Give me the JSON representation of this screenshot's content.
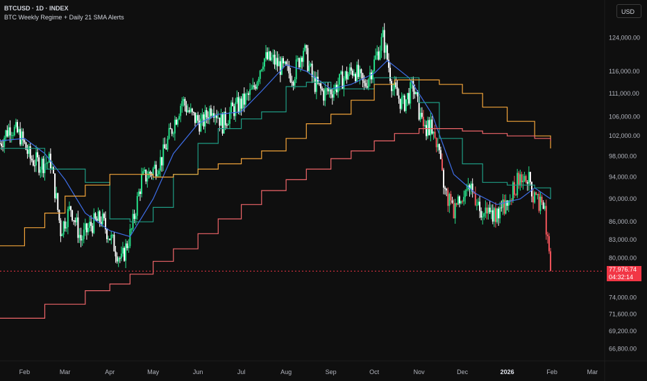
{
  "header": {
    "symbol_line": "BTCUSD · 1D · INDEX",
    "indicator_name": "BTC Weekly Regime + Daily 21 SMA Alerts",
    "currency_button": "USD"
  },
  "price_tag": {
    "price": "77,976.74",
    "countdown": "04:32:14"
  },
  "colors": {
    "background": "#0f0f0f",
    "candle_up": "#26e08a",
    "candle_down": "#ffffff",
    "candle_down_bear": "#f2545b",
    "sma21_daily": "#3e6ee8",
    "weekly_line_teal": "#1f9c84",
    "weekly_line_orange": "#f4a53a",
    "weekly_line_red": "#f0666a",
    "current_price": "#f23645"
  },
  "chart_data": {
    "type": "line",
    "title": "",
    "xlabel": "",
    "ylabel": "",
    "x_ticks": [
      {
        "label": "Feb",
        "bold": false
      },
      {
        "label": "Mar",
        "bold": false
      },
      {
        "label": "Apr",
        "bold": false
      },
      {
        "label": "May",
        "bold": false
      },
      {
        "label": "Jun",
        "bold": false
      },
      {
        "label": "Jul",
        "bold": false
      },
      {
        "label": "Aug",
        "bold": false
      },
      {
        "label": "Sep",
        "bold": false
      },
      {
        "label": "Oct",
        "bold": false
      },
      {
        "label": "Nov",
        "bold": false
      },
      {
        "label": "Dec",
        "bold": false
      },
      {
        "label": "2026",
        "bold": true
      },
      {
        "label": "Feb",
        "bold": false
      },
      {
        "label": "Mar",
        "bold": false
      }
    ],
    "y_ticks": [
      "124,000.00",
      "116,000.00",
      "111,000.00",
      "106,000.00",
      "102,000.00",
      "98,000.00",
      "94,000.00",
      "90,000.00",
      "86,000.00",
      "83,000.00",
      "80,000.00",
      "74,000.00",
      "71,600.00",
      "69,200.00",
      "66,800.00"
    ],
    "y_tick_values": [
      124000,
      116000,
      111000,
      106000,
      102000,
      98000,
      94000,
      90000,
      86000,
      83000,
      80000,
      74000,
      71600,
      69200,
      66800
    ],
    "y_scale": "log",
    "ylim": [
      65500,
      130000
    ],
    "x_range": [
      "2025-01-15",
      "2026-03-08"
    ],
    "last_price": 77976.74,
    "candles_close": [
      [
        "2025-01-15",
        100500
      ],
      [
        "2025-01-22",
        104000
      ],
      [
        "2025-01-29",
        102000
      ],
      [
        "2025-02-05",
        97500
      ],
      [
        "2025-02-12",
        96500
      ],
      [
        "2025-02-19",
        97000
      ],
      [
        "2025-02-26",
        84500
      ],
      [
        "2025-03-05",
        88500
      ],
      [
        "2025-03-12",
        83000
      ],
      [
        "2025-03-19",
        85500
      ],
      [
        "2025-03-26",
        86500
      ],
      [
        "2025-04-02",
        83000
      ],
      [
        "2025-04-09",
        79500
      ],
      [
        "2025-04-16",
        84500
      ],
      [
        "2025-04-23",
        93500
      ],
      [
        "2025-04-30",
        95000
      ],
      [
        "2025-05-07",
        97500
      ],
      [
        "2025-05-14",
        103500
      ],
      [
        "2025-05-21",
        109500
      ],
      [
        "2025-05-28",
        106000
      ],
      [
        "2025-06-04",
        104500
      ],
      [
        "2025-06-11",
        108500
      ],
      [
        "2025-06-18",
        104500
      ],
      [
        "2025-06-25",
        107500
      ],
      [
        "2025-07-02",
        109000
      ],
      [
        "2025-07-09",
        111500
      ],
      [
        "2025-07-16",
        119000
      ],
      [
        "2025-07-23",
        118500
      ],
      [
        "2025-07-30",
        116500
      ],
      [
        "2025-08-06",
        115000
      ],
      [
        "2025-08-13",
        121500
      ],
      [
        "2025-08-20",
        113500
      ],
      [
        "2025-08-27",
        111000
      ],
      [
        "2025-09-03",
        112000
      ],
      [
        "2025-09-10",
        114500
      ],
      [
        "2025-09-17",
        116500
      ],
      [
        "2025-09-24",
        112500
      ],
      [
        "2025-10-01",
        118000
      ],
      [
        "2025-10-07",
        124000
      ],
      [
        "2025-10-14",
        112000
      ],
      [
        "2025-10-21",
        108500
      ],
      [
        "2025-10-28",
        112500
      ],
      [
        "2025-11-04",
        103000
      ],
      [
        "2025-11-11",
        104500
      ],
      [
        "2025-11-18",
        92000
      ],
      [
        "2025-11-25",
        87500
      ],
      [
        "2025-12-02",
        91500
      ],
      [
        "2025-12-09",
        91000
      ],
      [
        "2025-12-16",
        87500
      ],
      [
        "2025-12-23",
        87500
      ],
      [
        "2025-12-30",
        88500
      ],
      [
        "2026-01-06",
        92000
      ],
      [
        "2026-01-13",
        95500
      ],
      [
        "2026-01-20",
        90000
      ],
      [
        "2026-01-27",
        88000
      ],
      [
        "2026-01-31",
        77977
      ]
    ],
    "series": [
      {
        "values": [
          [
            "2025-01-15",
            101000
          ],
          [
            "2025-02-01",
            101500
          ],
          [
            "2025-02-15",
            98500
          ],
          [
            "2025-03-01",
            93500
          ],
          [
            "2025-03-15",
            87500
          ],
          [
            "2025-04-01",
            84500
          ],
          [
            "2025-04-15",
            83500
          ],
          [
            "2025-05-01",
            90000
          ],
          [
            "2025-05-15",
            98500
          ],
          [
            "2025-06-01",
            104500
          ],
          [
            "2025-06-15",
            106500
          ],
          [
            "2025-07-01",
            107000
          ],
          [
            "2025-07-15",
            111500
          ],
          [
            "2025-08-01",
            117500
          ],
          [
            "2025-08-15",
            116000
          ],
          [
            "2025-09-01",
            112000
          ],
          [
            "2025-09-15",
            113000
          ],
          [
            "2025-10-01",
            115500
          ],
          [
            "2025-10-10",
            118500
          ],
          [
            "2025-10-25",
            114500
          ],
          [
            "2025-11-10",
            106500
          ],
          [
            "2025-11-25",
            94500
          ],
          [
            "2025-12-10",
            91000
          ],
          [
            "2025-12-25",
            89000
          ],
          [
            "2026-01-10",
            90000
          ],
          [
            "2026-01-20",
            92000
          ],
          [
            "2026-01-31",
            90000
          ]
        ]
      },
      {
        "values": [
          [
            "2025-01-15",
            99500
          ],
          [
            "2025-02-15",
            95500
          ],
          [
            "2025-03-15",
            93000
          ],
          [
            "2025-04-01",
            86500
          ],
          [
            "2025-04-15",
            86000
          ],
          [
            "2025-05-01",
            88500
          ],
          [
            "2025-05-15",
            94500
          ],
          [
            "2025-06-01",
            100500
          ],
          [
            "2025-06-15",
            103500
          ],
          [
            "2025-07-01",
            105500
          ],
          [
            "2025-07-15",
            107000
          ],
          [
            "2025-08-01",
            112500
          ],
          [
            "2025-08-15",
            113500
          ],
          [
            "2025-09-01",
            112000
          ],
          [
            "2025-09-15",
            112000
          ],
          [
            "2025-10-01",
            114500
          ],
          [
            "2025-10-15",
            114500
          ],
          [
            "2025-11-01",
            109000
          ],
          [
            "2025-11-15",
            101500
          ],
          [
            "2025-12-01",
            96500
          ],
          [
            "2025-12-15",
            93000
          ],
          [
            "2026-01-01",
            92500
          ],
          [
            "2026-01-20",
            92000
          ],
          [
            "2026-01-31",
            90000
          ]
        ]
      },
      {
        "values": [
          [
            "2025-01-15",
            82000
          ],
          [
            "2025-02-01",
            85000
          ],
          [
            "2025-02-15",
            87500
          ],
          [
            "2025-03-01",
            90500
          ],
          [
            "2025-03-15",
            92500
          ],
          [
            "2025-04-01",
            94500
          ],
          [
            "2025-04-15",
            94500
          ],
          [
            "2025-05-01",
            94000
          ],
          [
            "2025-05-15",
            94500
          ],
          [
            "2025-06-01",
            95500
          ],
          [
            "2025-06-15",
            96500
          ],
          [
            "2025-07-01",
            97500
          ],
          [
            "2025-07-15",
            99000
          ],
          [
            "2025-08-01",
            101500
          ],
          [
            "2025-08-15",
            104500
          ],
          [
            "2025-09-01",
            106500
          ],
          [
            "2025-09-15",
            109500
          ],
          [
            "2025-10-01",
            113000
          ],
          [
            "2025-10-15",
            114000
          ],
          [
            "2025-11-01",
            114000
          ],
          [
            "2025-11-15",
            113000
          ],
          [
            "2025-12-01",
            111000
          ],
          [
            "2025-12-15",
            108000
          ],
          [
            "2026-01-01",
            105000
          ],
          [
            "2026-01-20",
            102000
          ],
          [
            "2026-01-31",
            99500
          ]
        ]
      },
      {
        "values": [
          [
            "2025-01-15",
            71000
          ],
          [
            "2025-02-15",
            73000
          ],
          [
            "2025-03-15",
            75000
          ],
          [
            "2025-04-01",
            76000
          ],
          [
            "2025-04-15",
            77500
          ],
          [
            "2025-05-01",
            79500
          ],
          [
            "2025-05-15",
            81500
          ],
          [
            "2025-06-01",
            84000
          ],
          [
            "2025-06-15",
            86500
          ],
          [
            "2025-07-01",
            89000
          ],
          [
            "2025-07-15",
            91500
          ],
          [
            "2025-08-01",
            93500
          ],
          [
            "2025-08-15",
            95500
          ],
          [
            "2025-09-01",
            97500
          ],
          [
            "2025-09-15",
            99000
          ],
          [
            "2025-10-01",
            101000
          ],
          [
            "2025-10-15",
            102500
          ],
          [
            "2025-11-01",
            103500
          ],
          [
            "2025-11-15",
            103500
          ],
          [
            "2025-12-01",
            103000
          ],
          [
            "2025-12-15",
            102500
          ],
          [
            "2026-01-01",
            102000
          ],
          [
            "2026-01-20",
            101500
          ],
          [
            "2026-01-31",
            101000
          ]
        ]
      }
    ],
    "grid": false,
    "legend": "top-left"
  }
}
